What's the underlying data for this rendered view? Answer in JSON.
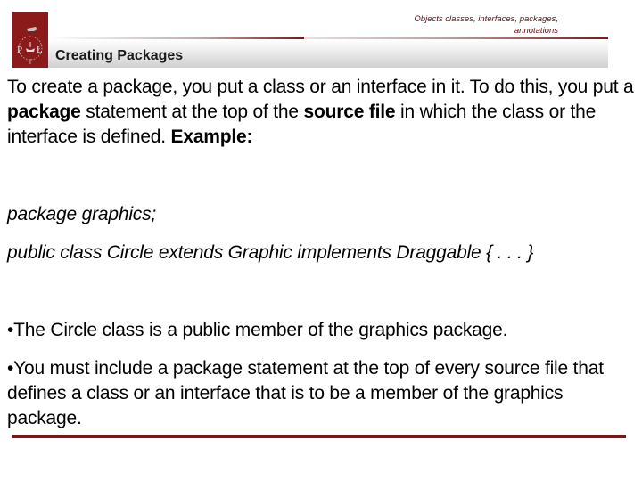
{
  "header": {
    "caption_line1": "Objects classes, interfaces, packages,",
    "caption_line2": "annotations",
    "logo_letters": {
      "left": "P",
      "right": "Ł"
    },
    "title": "Creating Packages"
  },
  "intro": {
    "part1": "To create a package, you put a class or an interface in it. To do this, you put a ",
    "bold1": "package",
    "part2": " statement at the top of the ",
    "bold2": "source file",
    "part3": " in which the class or the interface is defined. ",
    "bold3": "Example:"
  },
  "code": {
    "line1": "package graphics;",
    "line2": "public class Circle extends Graphic implements Draggable { . . . }"
  },
  "bullets": [
    {
      "marker": "•",
      "text": "The Circle class is a public member of the graphics package."
    },
    {
      "marker": "•",
      "text": "You must include a package statement at the top of every source file that defines a class or an interface that is to be a member of the graphics package."
    }
  ],
  "colors": {
    "brand": "#8b1a1a",
    "rule": "#7a1818",
    "caption": "#5a1010"
  }
}
